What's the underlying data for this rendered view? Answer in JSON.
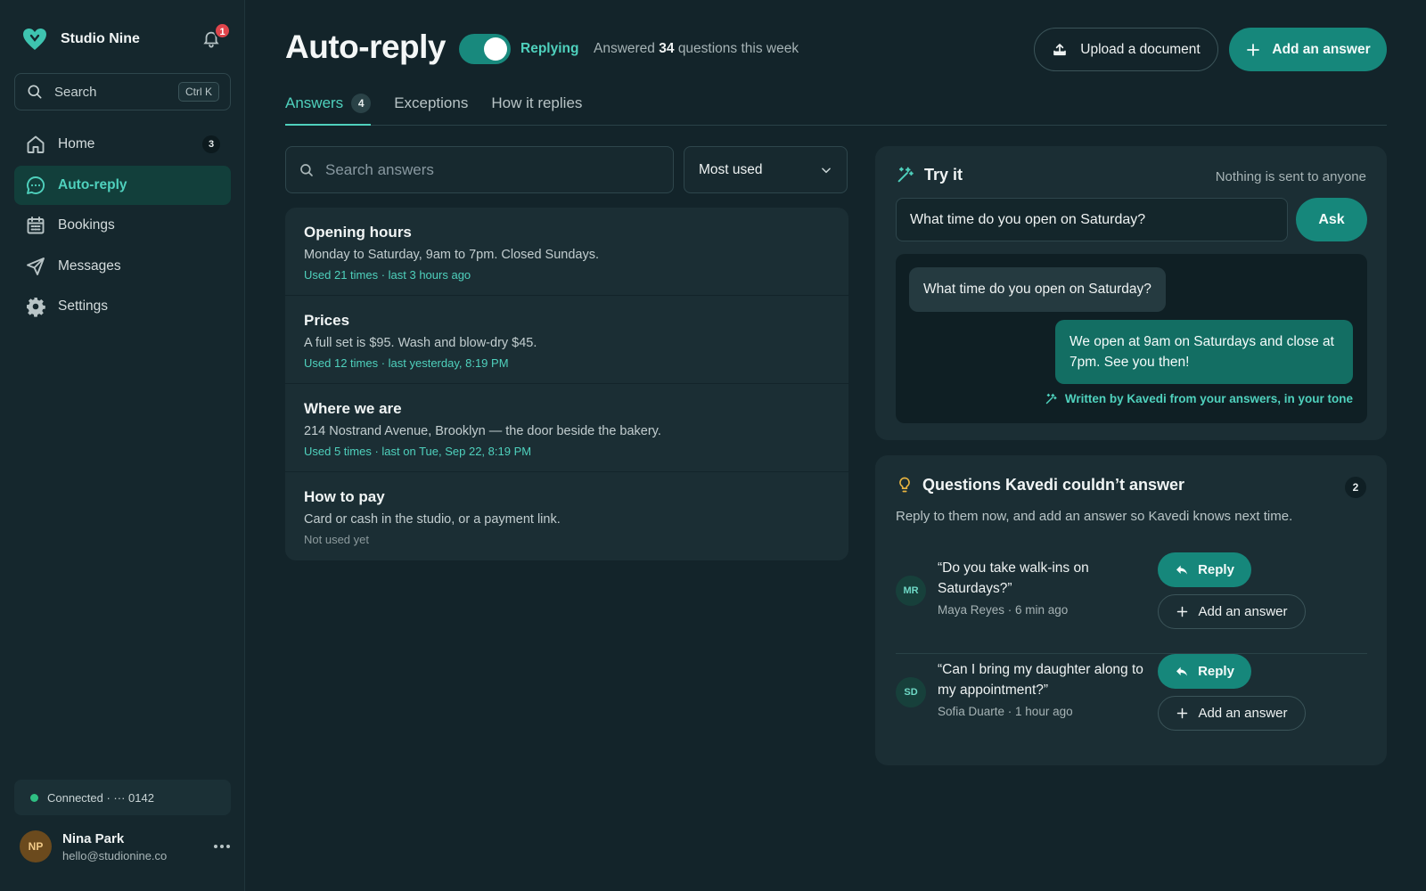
{
  "sidebar": {
    "brand_name": "Studio Nine",
    "notifications_count": "1",
    "search": {
      "label": "Search",
      "shortcut": "Ctrl K"
    },
    "nav": [
      {
        "label": "Home",
        "icon": "home-icon",
        "count": "3"
      },
      {
        "label": "Auto-reply",
        "icon": "chat-bubble-icon",
        "active": true
      },
      {
        "label": "Bookings",
        "icon": "calendar-icon"
      },
      {
        "label": "Messages",
        "icon": "send-icon"
      },
      {
        "label": "Settings",
        "icon": "gear-icon"
      }
    ],
    "connection": "Connected · ··· 0142",
    "user": {
      "initials": "NP",
      "name": "Nina Park",
      "email": "hello@studionine.co"
    }
  },
  "header": {
    "title": "Auto-reply",
    "toggle_label": "Replying",
    "toggle_on": true,
    "answered_prefix": "Answered",
    "answered_count": "34",
    "answered_suffix": "questions this week",
    "upload_label": "Upload a document",
    "add_label": "Add an answer"
  },
  "tabs": [
    {
      "label": "Answers",
      "count": "4",
      "active": true
    },
    {
      "label": "Exceptions"
    },
    {
      "label": "How it replies"
    }
  ],
  "answers": {
    "search_placeholder": "Search answers",
    "sort_value": "Most used",
    "items": [
      {
        "title": "Opening hours",
        "body": "Monday to Saturday, 9am to 7pm. Closed Sundays.",
        "meta": "Used 21 times · last 3 hours ago"
      },
      {
        "title": "Prices",
        "body": "A full set is $95. Wash and blow-dry $45.",
        "meta": "Used 12 times · last yesterday, 8:19 PM"
      },
      {
        "title": "Where we are",
        "body": "214 Nostrand Avenue, Brooklyn — the door beside the bakery.",
        "meta": "Used 5 times · last on Tue, Sep 22, 8:19 PM"
      },
      {
        "title": "How to pay",
        "body": "Card or cash in the studio, or a payment link.",
        "meta": "Not used yet"
      }
    ]
  },
  "try_it": {
    "title": "Try it",
    "note": "Nothing is sent to anyone",
    "input_value": "What time do you open on Saturday?",
    "ask_label": "Ask",
    "question": "What time do you open on Saturday?",
    "reply": "We open at 9am on Saturdays and close at 7pm. See you then!",
    "written_by": "Written by Kavedi from your answers, in your tone"
  },
  "unanswered": {
    "title": "Questions Kavedi couldn’t answer",
    "count": "2",
    "subtitle": "Reply to them now, and add an answer so Kavedi knows next time.",
    "reply_label": "Reply",
    "add_label": "Add an answer",
    "items": [
      {
        "initials": "MR",
        "question": "“Do you take walk-ins on Saturdays?”",
        "meta": "Maya Reyes · 6 min ago"
      },
      {
        "initials": "SD",
        "question": "“Can I bring my daughter along to my appointment?”",
        "meta": "Sofia Duarte · 1 hour ago"
      }
    ]
  },
  "colors": {
    "accent": "#4fd1bd",
    "primary_button": "#16877b",
    "background": "#13242a",
    "badge_red": "#e0454c"
  }
}
